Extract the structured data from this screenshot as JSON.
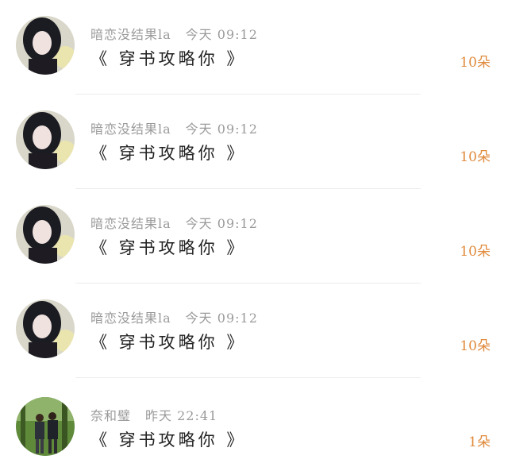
{
  "list": {
    "items": [
      {
        "user": "暗恋没结果la",
        "time": "今天 09:12",
        "title": "《 穿书攻略你 》",
        "count": "10朵",
        "avatar": "girl-photo-avatar"
      },
      {
        "user": "暗恋没结果la",
        "time": "今天 09:12",
        "title": "《 穿书攻略你 》",
        "count": "10朵",
        "avatar": "girl-photo-avatar"
      },
      {
        "user": "暗恋没结果la",
        "time": "今天 09:12",
        "title": "《 穿书攻略你 》",
        "count": "10朵",
        "avatar": "girl-photo-avatar"
      },
      {
        "user": "暗恋没结果la",
        "time": "今天 09:12",
        "title": "《 穿书攻略你 》",
        "count": "10朵",
        "avatar": "girl-photo-avatar"
      },
      {
        "user": "奈和璧",
        "time": "昨天 22:41",
        "title": "《 穿书攻略你 》",
        "count": "1朵",
        "avatar": "forest-couple-avatar"
      }
    ]
  },
  "colors": {
    "count_accent": "#e08a3c",
    "meta_text": "#9a9a9a",
    "title_text": "#222222"
  }
}
